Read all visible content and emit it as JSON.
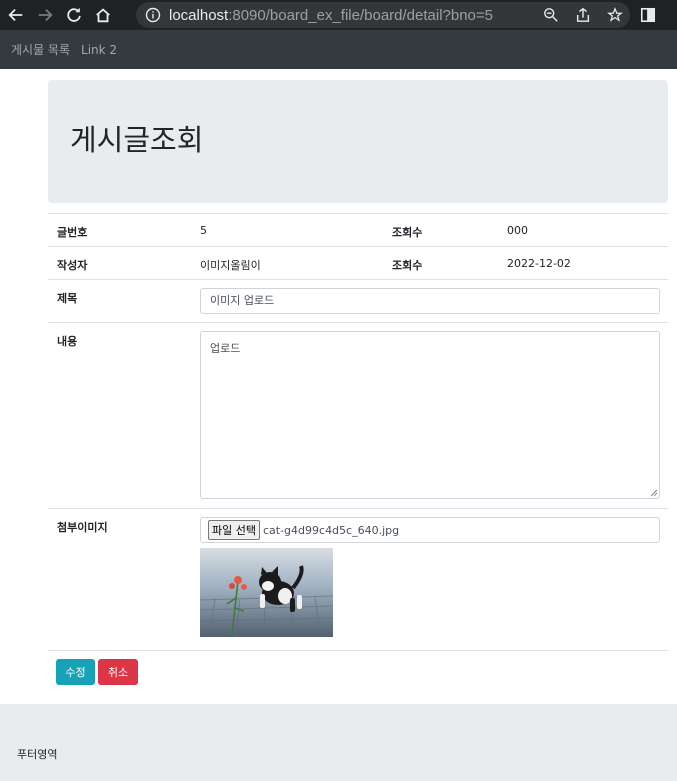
{
  "browser": {
    "url_host": "localhost",
    "url_rest": ":8090/board_ex_file/board/detail?bno=5"
  },
  "navbar": {
    "link1": "게시물 목록",
    "link2": "Link 2"
  },
  "jumbotron": {
    "title": "게시글조회"
  },
  "detail": {
    "row1": {
      "label1": "글번호",
      "value1": "5",
      "label2": "조회수",
      "value2": "000"
    },
    "row2": {
      "label1": "작성자",
      "value1": "이미지올림이",
      "label2": "조회수",
      "value2": "2022-12-02"
    },
    "title_label": "제목",
    "title_value": "이미지 업로드",
    "content_label": "내용",
    "content_value": "업로드",
    "attach_label": "첨부이미지",
    "file_button": "파일 선택",
    "file_name": "cat-g4d99c4d5c_640.jpg"
  },
  "buttons": {
    "edit": "수정",
    "cancel": "취소"
  },
  "footer": {
    "text": "푸터영역"
  }
}
